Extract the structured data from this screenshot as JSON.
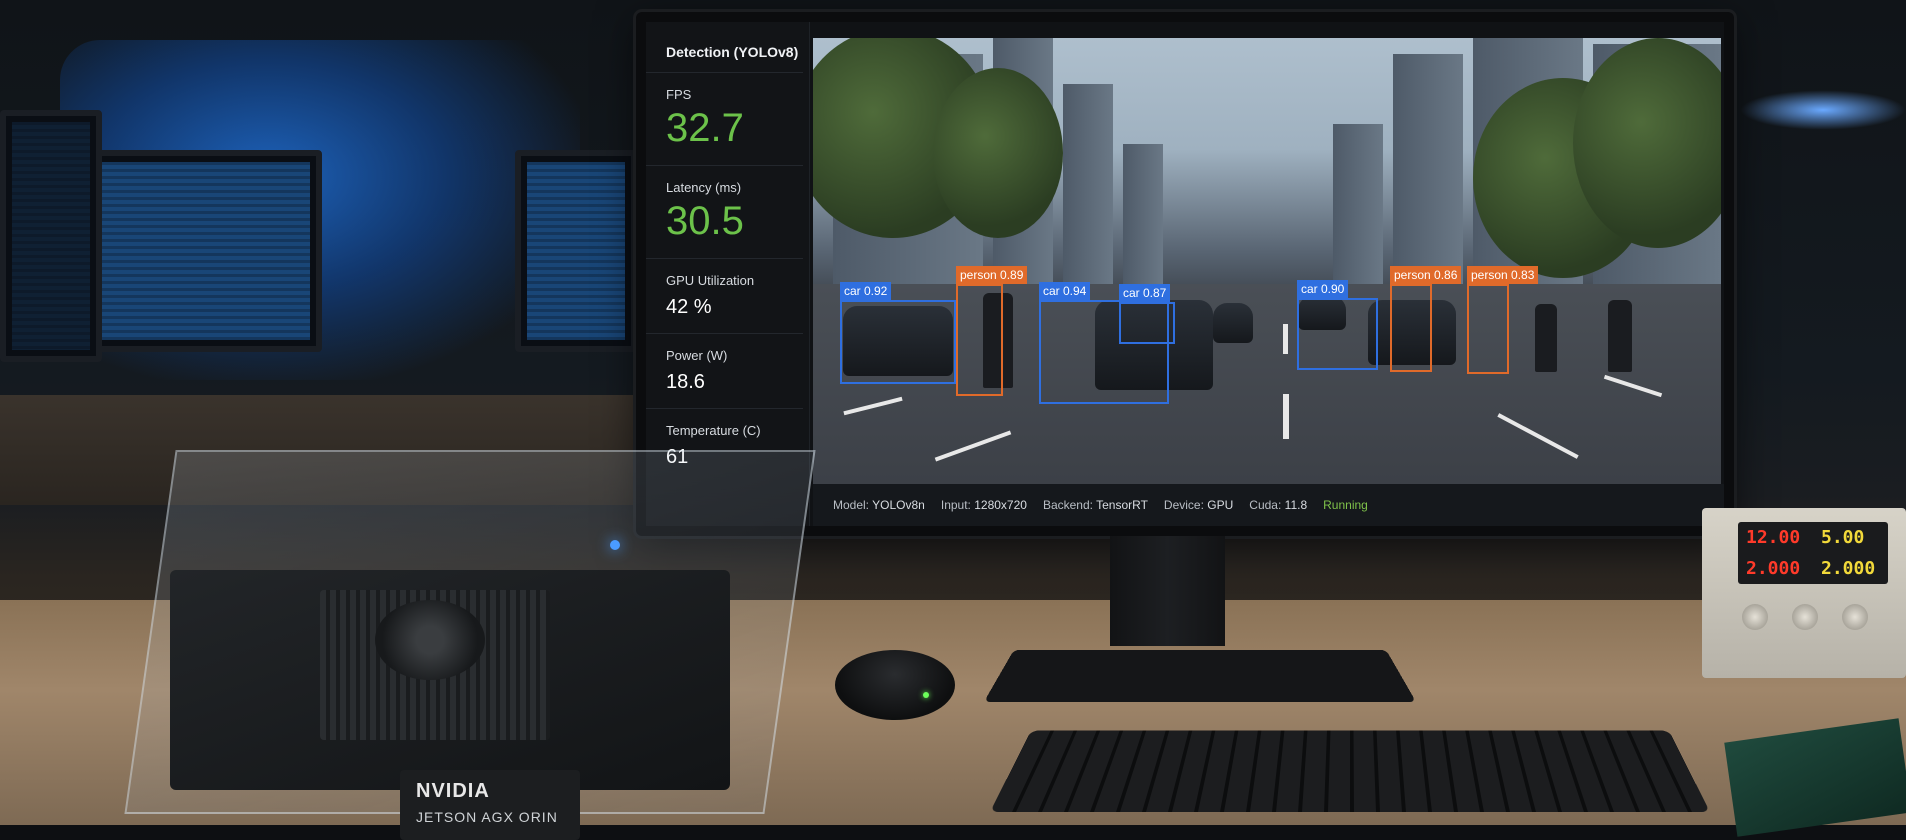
{
  "panel": {
    "title": "Detection (YOLOv8)",
    "metrics": [
      {
        "label": "FPS",
        "value": "32.7"
      },
      {
        "label": "Latency (ms)",
        "value": "30.5"
      },
      {
        "label": "GPU Utilization",
        "value": "42 %"
      },
      {
        "label": "Power (W)",
        "value": "18.6"
      },
      {
        "label": "Temperature (C)",
        "value": "61"
      }
    ]
  },
  "detections": [
    {
      "label": "car 0.92",
      "color": "blue"
    },
    {
      "label": "person 0.89",
      "color": "orange"
    },
    {
      "label": "car 0.94",
      "color": "blue"
    },
    {
      "label": "car 0.87",
      "color": "blue"
    },
    {
      "label": "car 0.90",
      "color": "blue"
    },
    {
      "label": "person 0.86",
      "color": "orange"
    },
    {
      "label": "person 0.83",
      "color": "orange"
    }
  ],
  "status_bar": {
    "model_key": "Model:",
    "model_val": "YOLOv8n",
    "input_key": "Input:",
    "input_val": "1280x720",
    "backend_key": "Backend:",
    "backend_val": "TensorRT",
    "device_key": "Device:",
    "device_val": "GPU",
    "cuda_key": "Cuda:",
    "cuda_val": "11.8",
    "state": "Running"
  },
  "hardware": {
    "logo": "NVIDIA",
    "model": "JETSON AGX ORIN"
  },
  "psu_display": {
    "v1": "12.00",
    "a1": "5.00",
    "v2": "2.000",
    "a2": "2.000"
  },
  "colors": {
    "accent_green": "#6cc24a",
    "box_blue": "#2f6fe0",
    "box_orange": "#e06a2a"
  }
}
